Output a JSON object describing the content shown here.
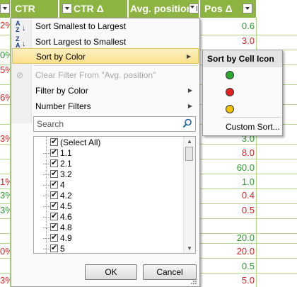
{
  "sheet": {
    "headers": [
      {
        "label": "CTR",
        "filtered": false
      },
      {
        "label": "CTR Δ",
        "filtered": false
      },
      {
        "label": "Avg. position",
        "filtered": true
      },
      {
        "label": "Pos Δ",
        "filtered": false
      }
    ],
    "left_cells": [
      {
        "text": "2%",
        "color": "red"
      },
      {
        "text": "0%",
        "color": "green"
      },
      {
        "text": "5%",
        "color": "red"
      },
      {
        "text": "6%",
        "color": "red"
      },
      {
        "text": "3%",
        "color": "red"
      },
      {
        "text": "1%",
        "color": "red"
      },
      {
        "text": "3%",
        "color": "green"
      },
      {
        "text": "3%",
        "color": "green"
      },
      {
        "text": "0%",
        "color": "red"
      },
      {
        "text": "3%",
        "color": "red"
      }
    ],
    "right_cells": [
      {
        "text": "0.6",
        "color": "green"
      },
      {
        "text": "3.0",
        "color": "red"
      },
      {
        "text": "3.0",
        "color": "green"
      },
      {
        "text": "8.0",
        "color": "red"
      },
      {
        "text": "60.0",
        "color": "green"
      },
      {
        "text": "1.0",
        "color": "green"
      },
      {
        "text": "0.4",
        "color": "red"
      },
      {
        "text": "0.5",
        "color": "red"
      },
      {
        "text": "20.0",
        "color": "green"
      },
      {
        "text": "20.0",
        "color": "red"
      },
      {
        "text": "0.5",
        "color": "green"
      },
      {
        "text": "5.0",
        "color": "red"
      }
    ]
  },
  "menu": {
    "sort_asc": "Sort Smallest to Largest",
    "sort_desc": "Sort Largest to Smallest",
    "sort_by_color": "Sort by Color",
    "clear_filter": "Clear Filter From \"Avg. position\"",
    "filter_by_color": "Filter by Color",
    "number_filters": "Number Filters",
    "search_placeholder": "Search",
    "list_items": [
      "(Select All)",
      "1.1",
      "2.1",
      "3.2",
      "4",
      "4.2",
      "4.5",
      "4.6",
      "4.8",
      "4.9",
      "5"
    ],
    "ok": "OK",
    "cancel": "Cancel"
  },
  "submenu": {
    "title": "Sort by Cell Icon",
    "icons": [
      "green-circle-icon",
      "red-circle-icon",
      "yellow-circle-icon"
    ],
    "icon_colors": {
      "green": "#2eaa2e",
      "red": "#e32020",
      "yellow": "#f2c200"
    },
    "custom_sort": "Custom Sort..."
  }
}
